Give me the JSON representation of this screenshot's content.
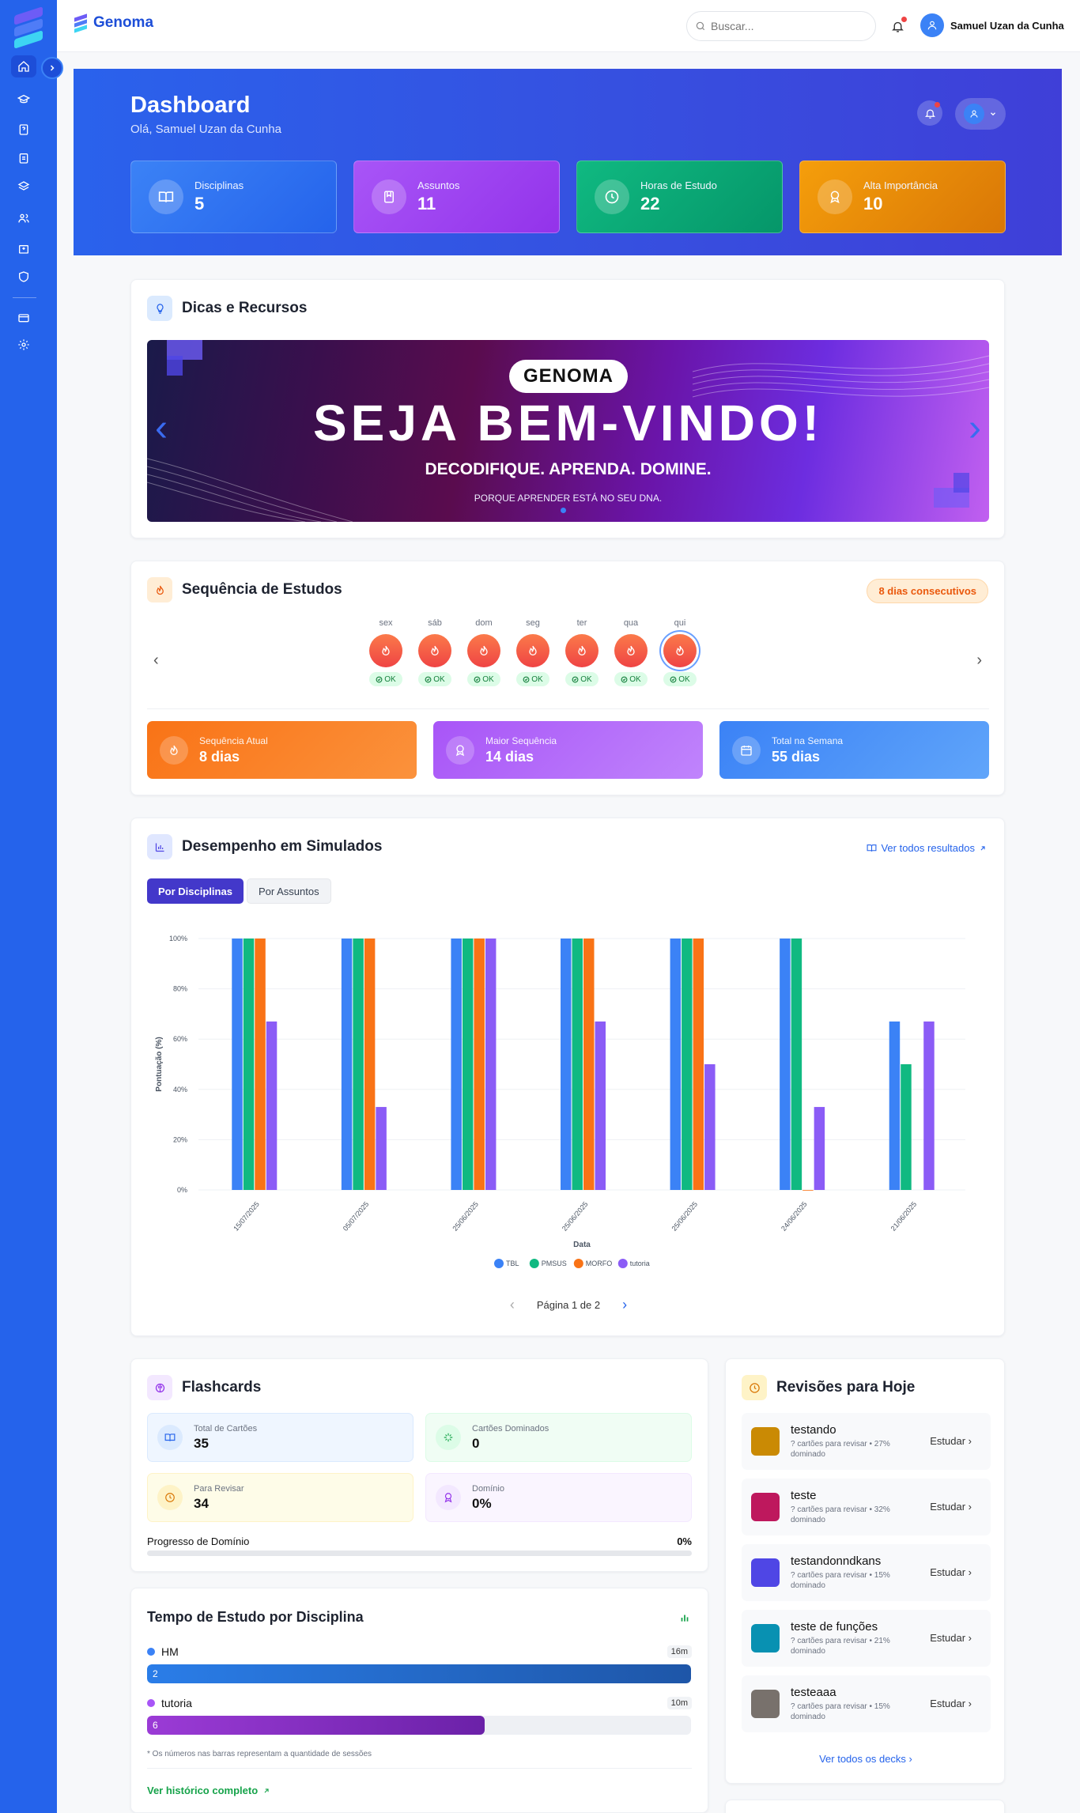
{
  "app": {
    "brand": "Genoma"
  },
  "search": {
    "placeholder": "Buscar..."
  },
  "user": {
    "name": "Samuel Uzan da Cunha"
  },
  "hero": {
    "title": "Dashboard",
    "greeting": "Olá, Samuel Uzan da Cunha"
  },
  "stats": [
    {
      "label": "Disciplinas",
      "value": "5",
      "color": "#3b82f6",
      "icon": "book-open-icon"
    },
    {
      "label": "Assuntos",
      "value": "11",
      "color": "#a855f7",
      "icon": "book-icon"
    },
    {
      "label": "Horas de Estudo",
      "value": "22",
      "color": "#10b981",
      "icon": "clock-icon"
    },
    {
      "label": "Alta Importância",
      "value": "10",
      "color": "#f59e0b",
      "icon": "award-icon"
    }
  ],
  "tips": {
    "title": "Dicas e Recursos",
    "banner_logo": "GENOMA",
    "banner_title": "SEJA BEM-VINDO!",
    "banner_subtitle": "DECODIFIQUE. APRENDA. DOMINE.",
    "banner_tagline": "PORQUE APRENDER ESTÁ NO SEU DNA."
  },
  "streak": {
    "title": "Sequência de Estudos",
    "badge": "8 dias consecutivos",
    "days": [
      {
        "name": "sex",
        "ok": "OK"
      },
      {
        "name": "sáb",
        "ok": "OK"
      },
      {
        "name": "dom",
        "ok": "OK"
      },
      {
        "name": "seg",
        "ok": "OK"
      },
      {
        "name": "ter",
        "ok": "OK"
      },
      {
        "name": "qua",
        "ok": "OK"
      },
      {
        "name": "qui",
        "ok": "OK"
      }
    ],
    "current_label": "Sequência Atual",
    "current_value": "8 dias",
    "max_label": "Maior Sequência",
    "max_value": "14 dias",
    "week_label": "Total na Semana",
    "week_value": "55 dias"
  },
  "performance": {
    "title": "Desempenho em Simulados",
    "view_all": "Ver todos resultados",
    "tab_disciplinas": "Por Disciplinas",
    "tab_assuntos": "Por Assuntos",
    "pagination": "Página 1 de 2"
  },
  "chart_data": {
    "type": "bar",
    "xlabel": "Data",
    "ylabel": "Pontuação (%)",
    "ylim": [
      0,
      100
    ],
    "yticks": [
      "0%",
      "20%",
      "40%",
      "60%",
      "80%",
      "100%"
    ],
    "categories": [
      "15/07/2025",
      "05/07/2025",
      "25/06/2025",
      "25/06/2025",
      "25/06/2025",
      "24/06/2025",
      "21/06/2025"
    ],
    "series": [
      {
        "name": "TBL",
        "color": "#3b82f6",
        "values": [
          100,
          100,
          100,
          100,
          100,
          100,
          67
        ]
      },
      {
        "name": "PMSUS",
        "color": "#10b981",
        "values": [
          100,
          100,
          100,
          100,
          100,
          100,
          50
        ]
      },
      {
        "name": "MORFO",
        "color": "#f97316",
        "values": [
          100,
          100,
          100,
          100,
          100,
          0,
          null
        ]
      },
      {
        "name": "tutoria",
        "color": "#8b5cf6",
        "values": [
          67,
          33,
          100,
          67,
          50,
          33,
          67
        ]
      }
    ],
    "legend": "bottom"
  },
  "flashcards": {
    "title": "Flashcards",
    "total_label": "Total de Cartões",
    "total_value": "35",
    "dominated_label": "Cartões Dominados",
    "dominated_value": "0",
    "review_label": "Para Revisar",
    "review_value": "34",
    "domain_label": "Domínio",
    "domain_value": "0%",
    "progress_label": "Progresso de Domínio",
    "progress_value": "0%",
    "progress_fraction": 0
  },
  "study_time": {
    "title": "Tempo de Estudo por Disciplina",
    "items": [
      {
        "name": "HM",
        "time": "16m",
        "sessions": "2",
        "fraction": 1.0,
        "color": "#2563eb"
      },
      {
        "name": "tutoria",
        "time": "10m",
        "sessions": "6",
        "fraction": 0.62,
        "color": "#9333ea"
      }
    ],
    "note": "* Os números nas barras representam a quantidade de sessões",
    "history_link": "Ver histórico completo"
  },
  "reviews": {
    "title": "Revisões para Hoje",
    "study_label": "Estudar",
    "decks": [
      {
        "name": "testando",
        "meta": "? cartões para revisar • 27% dominado",
        "color": "#ca8a04"
      },
      {
        "name": "teste",
        "meta": "? cartões para revisar • 32% dominado",
        "color": "#be185d"
      },
      {
        "name": "testandonndkans",
        "meta": "? cartões para revisar • 15% dominado",
        "color": "#4f46e5"
      },
      {
        "name": "teste de funções",
        "meta": "? cartões para revisar • 21% dominado",
        "color": "#0891b2"
      },
      {
        "name": "testeaaa",
        "meta": "? cartões para revisar • 15% dominado",
        "color": "#78716c"
      }
    ],
    "view_all": "Ver todos os decks"
  }
}
